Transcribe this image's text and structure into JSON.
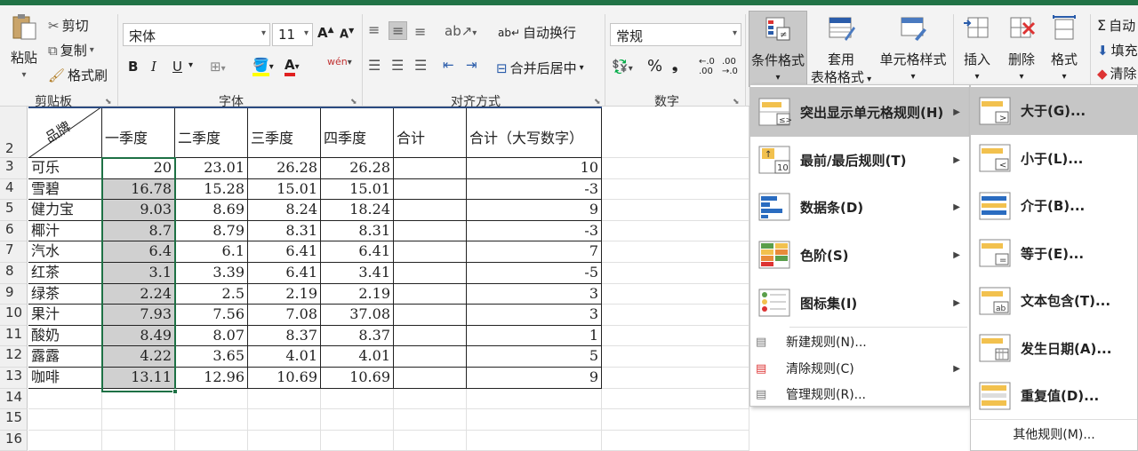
{
  "ribbon": {
    "clipboard": {
      "paste": "粘贴",
      "cut": "剪切",
      "copy": "复制",
      "format_painter": "格式刷",
      "group": "剪贴板"
    },
    "font": {
      "name": "宋体",
      "size": "11",
      "bold": "B",
      "italic": "I",
      "underline": "U",
      "phonetic": "wén",
      "group": "字体"
    },
    "alignment": {
      "wrap": "自动换行",
      "merge": "合并后居中",
      "group": "对齐方式"
    },
    "number": {
      "format": "常规",
      "percent": "%",
      "comma": "❟",
      "inc": "←.0 .00",
      "dec": ".00 →.0",
      "group": "数字"
    },
    "styles": {
      "conditional": "条件格式",
      "table_format_1": "套用",
      "table_format_2": "表格格式",
      "cell_styles": "单元格样式"
    },
    "cells": {
      "insert": "插入",
      "delete": "删除",
      "format": "格式"
    },
    "editing": {
      "autosum": "自动",
      "fill": "填充",
      "clear": "清除"
    }
  },
  "sheet": {
    "header_diag": "品牌",
    "headers": [
      "一季度",
      "二季度",
      "三季度",
      "四季度",
      "合计",
      "合计（大写数字）"
    ],
    "rows": [
      {
        "n": "3",
        "brand": "可乐",
        "q1": "20",
        "q2": "23.01",
        "q3": "26.28",
        "q4": "26.28",
        "sum": "",
        "big": "10"
      },
      {
        "n": "4",
        "brand": "雪碧",
        "q1": "16.78",
        "q2": "15.28",
        "q3": "15.01",
        "q4": "15.01",
        "sum": "",
        "big": "-3"
      },
      {
        "n": "5",
        "brand": "健力宝",
        "q1": "9.03",
        "q2": "8.69",
        "q3": "8.24",
        "q4": "18.24",
        "sum": "",
        "big": "9"
      },
      {
        "n": "6",
        "brand": "椰汁",
        "q1": "8.7",
        "q2": "8.79",
        "q3": "8.31",
        "q4": "8.31",
        "sum": "",
        "big": "-3"
      },
      {
        "n": "7",
        "brand": "汽水",
        "q1": "6.4",
        "q2": "6.1",
        "q3": "6.41",
        "q4": "6.41",
        "sum": "",
        "big": "7"
      },
      {
        "n": "8",
        "brand": "红茶",
        "q1": "3.1",
        "q2": "3.39",
        "q3": "6.41",
        "q4": "3.41",
        "sum": "",
        "big": "-5"
      },
      {
        "n": "9",
        "brand": "绿茶",
        "q1": "2.24",
        "q2": "2.5",
        "q3": "2.19",
        "q4": "2.19",
        "sum": "",
        "big": "3"
      },
      {
        "n": "10",
        "brand": "果汁",
        "q1": "7.93",
        "q2": "7.56",
        "q3": "7.08",
        "q4": "37.08",
        "sum": "",
        "big": "3"
      },
      {
        "n": "11",
        "brand": "酸奶",
        "q1": "8.49",
        "q2": "8.07",
        "q3": "8.37",
        "q4": "8.37",
        "sum": "",
        "big": "1"
      },
      {
        "n": "12",
        "brand": "露露",
        "q1": "4.22",
        "q2": "3.65",
        "q3": "4.01",
        "q4": "4.01",
        "sum": "",
        "big": "5"
      },
      {
        "n": "13",
        "brand": "咖啡",
        "q1": "13.11",
        "q2": "12.96",
        "q3": "10.69",
        "q4": "10.69",
        "sum": "",
        "big": "9"
      }
    ],
    "header_row_num": "2",
    "extra_rows": [
      "14",
      "15",
      "16"
    ]
  },
  "cf_menu": {
    "items": [
      {
        "label": "突出显示单元格规则(H)",
        "icon": "highlight-cells-icon"
      },
      {
        "label": "最前/最后规则(T)",
        "icon": "top-bottom-icon"
      },
      {
        "label": "数据条(D)",
        "icon": "data-bars-icon"
      },
      {
        "label": "色阶(S)",
        "icon": "color-scales-icon"
      },
      {
        "label": "图标集(I)",
        "icon": "icon-sets-icon"
      }
    ],
    "small_items": [
      {
        "label": "新建规则(N)..."
      },
      {
        "label": "清除规则(C)"
      },
      {
        "label": "管理规则(R)..."
      }
    ]
  },
  "sub_menu": {
    "items": [
      {
        "label": "大于(G)..."
      },
      {
        "label": "小于(L)..."
      },
      {
        "label": "介于(B)..."
      },
      {
        "label": "等于(E)..."
      },
      {
        "label": "文本包含(T)..."
      },
      {
        "label": "发生日期(A)..."
      },
      {
        "label": "重复值(D)..."
      }
    ],
    "more": "其他规则(M)..."
  },
  "colors": {
    "accent": "#217346",
    "selection": "#1e7145",
    "shade": "#d0d0d0"
  }
}
